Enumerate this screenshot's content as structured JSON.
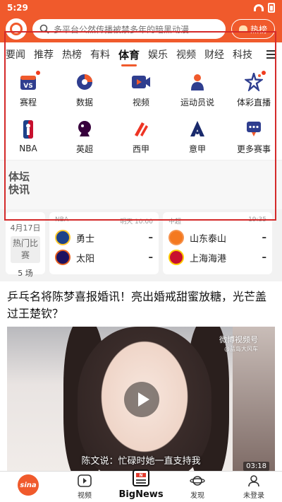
{
  "status": {
    "time": "5:29"
  },
  "search": {
    "placeholder": "多平台公然传播被禁多年的暗黑动漫",
    "hot_label": "热榜"
  },
  "tabs": [
    "要闻",
    "推荐",
    "热榜",
    "有料",
    "体育",
    "娱乐",
    "视频",
    "财经",
    "科技",
    "军"
  ],
  "active_tab": "体育",
  "grid": [
    {
      "label": "赛程",
      "icon": "vs-calendar-icon",
      "dot": true
    },
    {
      "label": "数据",
      "icon": "pie-chart-icon",
      "dot": false
    },
    {
      "label": "视频",
      "icon": "video-camera-icon",
      "dot": false
    },
    {
      "label": "运动员说",
      "icon": "athlete-icon",
      "dot": false
    },
    {
      "label": "体彩直播",
      "icon": "star-lottery-icon",
      "dot": true
    },
    {
      "label": "NBA",
      "icon": "nba-logo-icon",
      "dot": false
    },
    {
      "label": "英超",
      "icon": "premier-league-icon",
      "dot": false
    },
    {
      "label": "西甲",
      "icon": "laliga-icon",
      "dot": false
    },
    {
      "label": "意甲",
      "icon": "serie-a-icon",
      "dot": false
    },
    {
      "label": "更多赛事",
      "icon": "trophy-more-icon",
      "dot": false
    }
  ],
  "forum": {
    "line1": "体坛",
    "line2": "快讯"
  },
  "scores": {
    "date": "4月17日",
    "chip": "热门比赛",
    "count": "5 场",
    "matches": [
      {
        "league": "NBA",
        "time": "明天 10:00",
        "teams": [
          {
            "name": "勇士",
            "score": "–"
          },
          {
            "name": "太阳",
            "score": "–"
          }
        ]
      },
      {
        "league": "中超",
        "time": "19:35",
        "teams": [
          {
            "name": "山东泰山",
            "score": "–"
          },
          {
            "name": "上海海港",
            "score": "–"
          }
        ]
      }
    ]
  },
  "article": {
    "headline": "乒乓名将陈梦喜报婚讯！亮出婚戒甜蜜放糖，光芒盖过王楚钦？",
    "watermark": "微博视频号",
    "watermark_sub": "@蓝岛大风车",
    "subtitle": "陈文说：忙碌时她一直支持我",
    "duration": "03:18"
  },
  "nav": [
    {
      "label": "",
      "icon": "sina-home-icon"
    },
    {
      "label": "视频",
      "icon": "video-play-icon"
    },
    {
      "label": "BigNews",
      "icon": "bignews-icon"
    },
    {
      "label": "发现",
      "icon": "planet-icon"
    },
    {
      "label": "未登录",
      "icon": "user-icon"
    }
  ],
  "colors": {
    "brand": "#f05a2c",
    "highlight_box": "#d42a2a"
  }
}
